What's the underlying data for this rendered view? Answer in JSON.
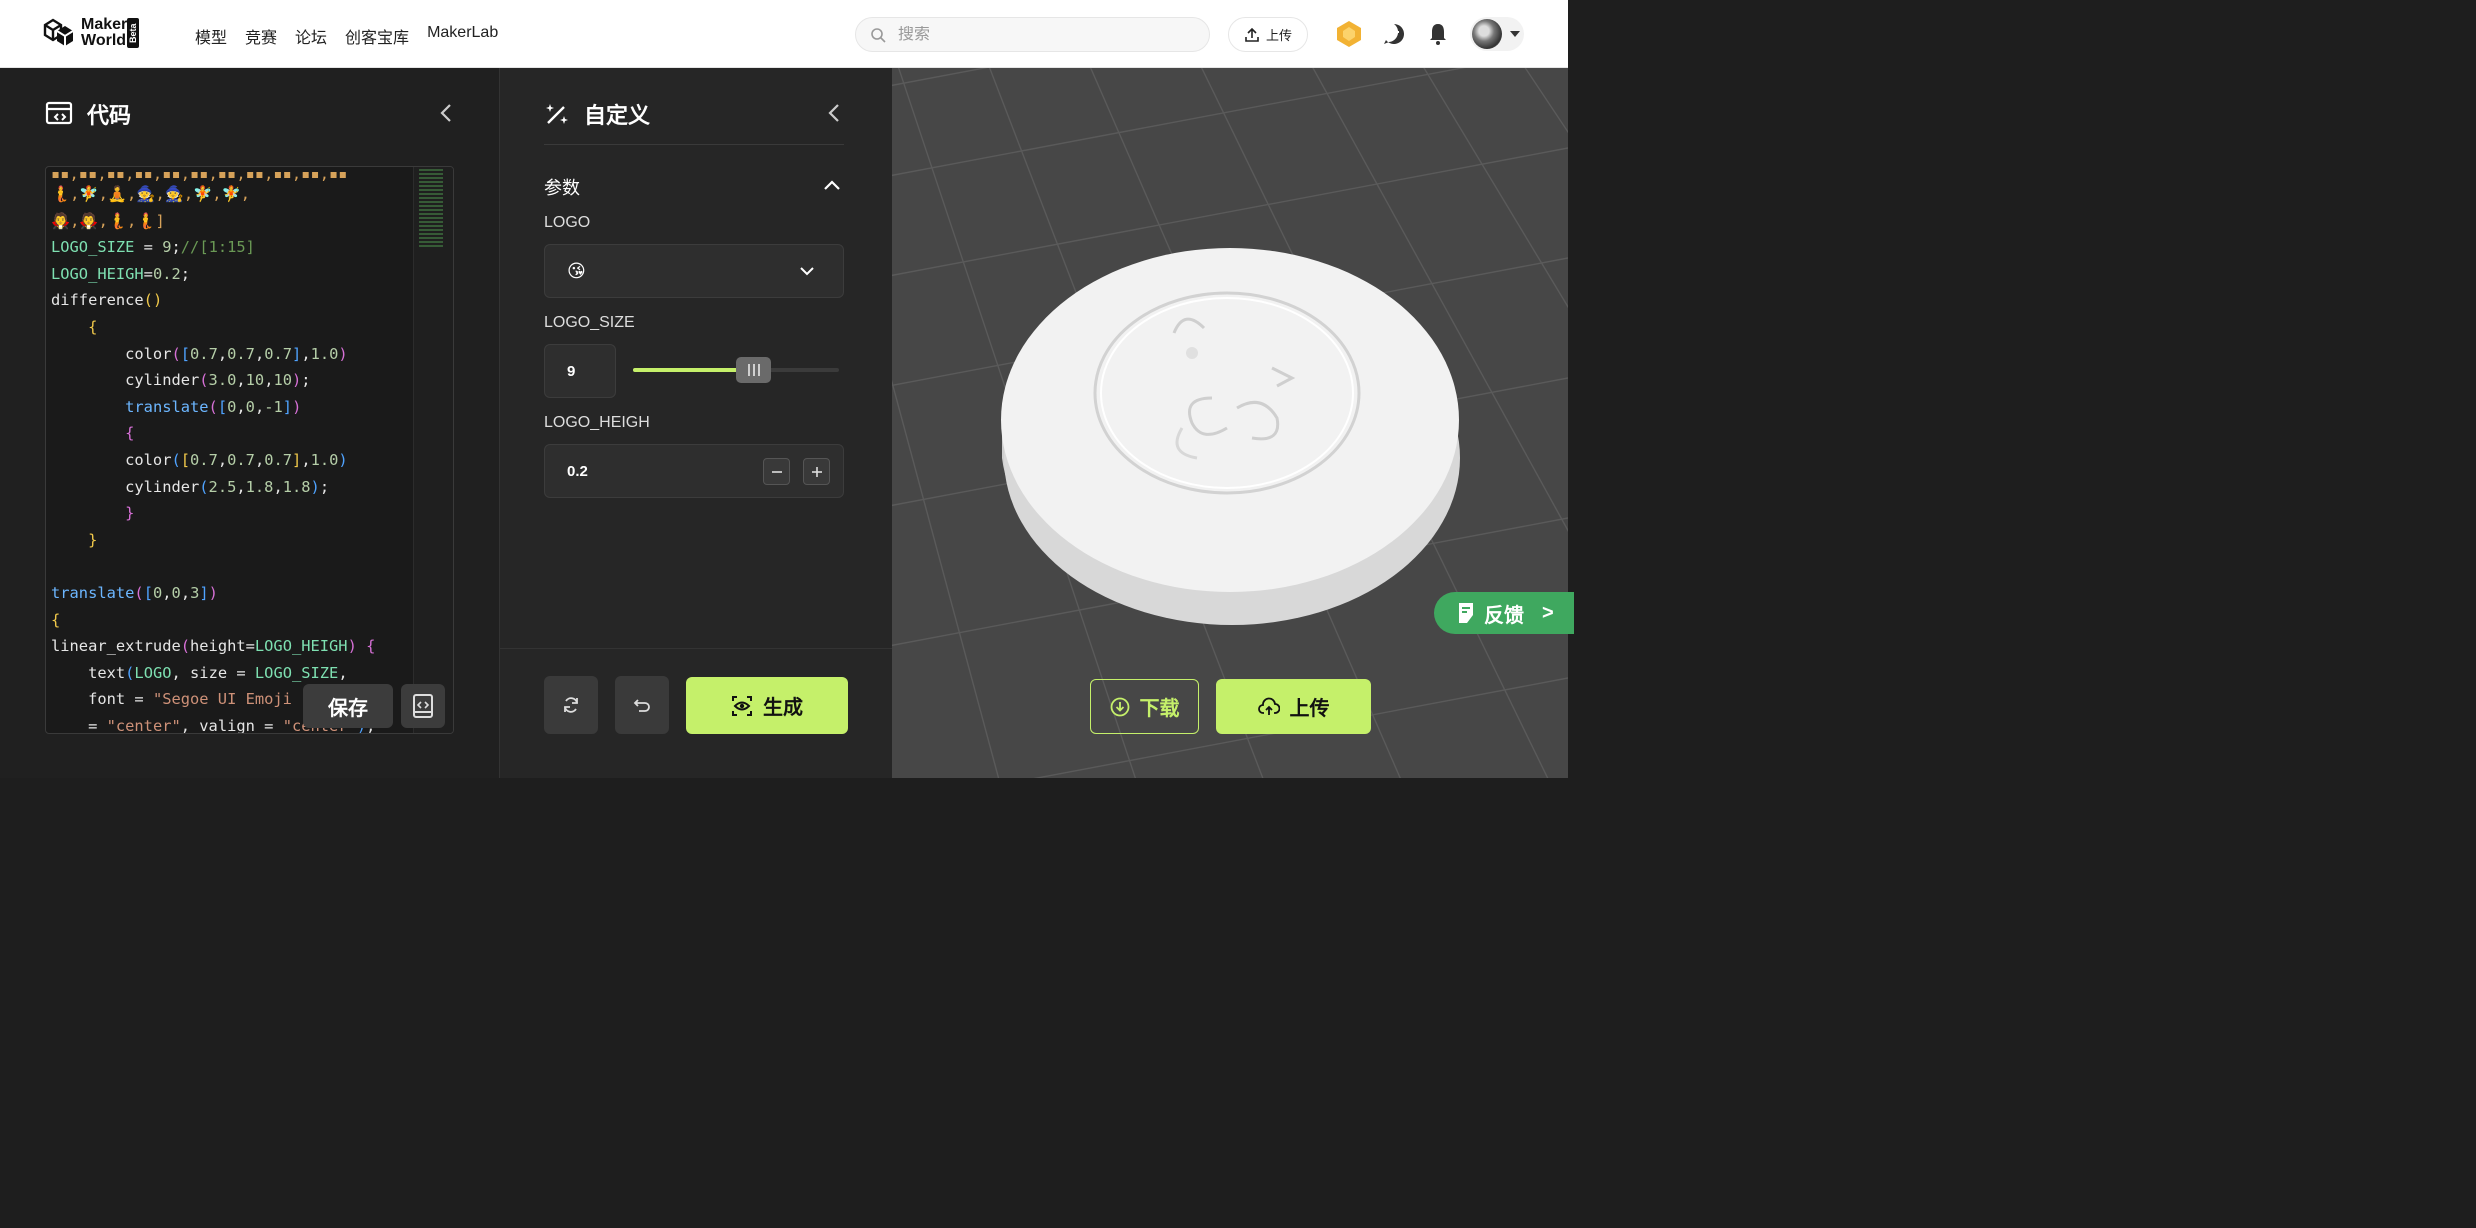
{
  "brand": {
    "name_line1": "Maker",
    "name_line2": "World",
    "badge": "Beta"
  },
  "nav": {
    "items": [
      "模型",
      "竞赛",
      "论坛",
      "创客宝库",
      "MakerLab"
    ]
  },
  "search": {
    "placeholder": "搜索",
    "value": ""
  },
  "header_actions": {
    "upload_label": "上传"
  },
  "code_panel": {
    "title": "代码",
    "save_label": "保存"
  },
  "custom_panel": {
    "title": "自定义",
    "section": "参数",
    "params": {
      "logo": {
        "label": "LOGO",
        "value": "😘"
      },
      "logo_size": {
        "label": "LOGO_SIZE",
        "value": "9",
        "fraction": 0.53
      },
      "logo_heigh": {
        "label": "LOGO_HEIGH",
        "value": "0.2"
      }
    },
    "generate_label": "生成"
  },
  "viewport": {
    "download_label": "下载",
    "upload_label": "上传"
  },
  "feedback": {
    "label": "反馈",
    "arrow": ">"
  },
  "colors": {
    "accent": "#c5f06a",
    "feedback": "#3fa85f"
  },
  "icons": [
    "search-icon",
    "upload-icon",
    "badge-icon",
    "message-icon",
    "bell-icon",
    "code-window-icon",
    "wand-icon",
    "refresh-icon",
    "undo-icon",
    "eye-scan-icon",
    "download-circle-icon",
    "cloud-upload-icon",
    "note-icon",
    "book-icon",
    "chevron-left-icon",
    "chevron-up-icon",
    "chevron-down-icon",
    "minus-icon",
    "plus-icon"
  ]
}
